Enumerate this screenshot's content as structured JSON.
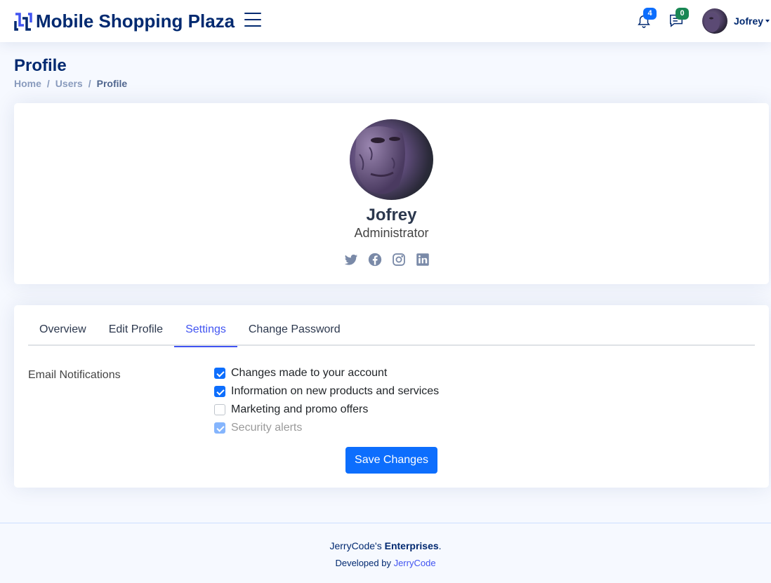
{
  "header": {
    "brand": "Mobile Shopping Plaza",
    "notifications_count": "4",
    "messages_count": "0",
    "user_name": "Jofrey"
  },
  "page": {
    "title": "Profile",
    "breadcrumb": [
      "Home",
      "Users",
      "Profile"
    ]
  },
  "profile": {
    "name": "Jofrey",
    "role": "Administrator",
    "social": [
      "twitter-icon",
      "facebook-icon",
      "instagram-icon",
      "linkedin-icon"
    ]
  },
  "tabs": [
    {
      "label": "Overview",
      "active": false
    },
    {
      "label": "Edit Profile",
      "active": false
    },
    {
      "label": "Settings",
      "active": true
    },
    {
      "label": "Change Password",
      "active": false
    }
  ],
  "settings": {
    "email_label": "Email Notifications",
    "options": [
      {
        "label": "Changes made to your account",
        "checked": true,
        "disabled": false
      },
      {
        "label": "Information on new products and services",
        "checked": true,
        "disabled": false
      },
      {
        "label": "Marketing and promo offers",
        "checked": false,
        "disabled": false
      },
      {
        "label": "Security alerts",
        "checked": true,
        "disabled": true
      }
    ],
    "save_label": "Save Changes"
  },
  "footer": {
    "copyright_prefix": "JerryCode's ",
    "copyright_bold": "Enterprises",
    "copyright_suffix": ".",
    "credits_prefix": "Developed by ",
    "credits_link": "JerryCode"
  },
  "colors": {
    "brand": "#012970",
    "accent": "#4154f1",
    "primary_button": "#0d6efd",
    "badge_notifications": "#0d6efd",
    "badge_messages": "#198754"
  }
}
